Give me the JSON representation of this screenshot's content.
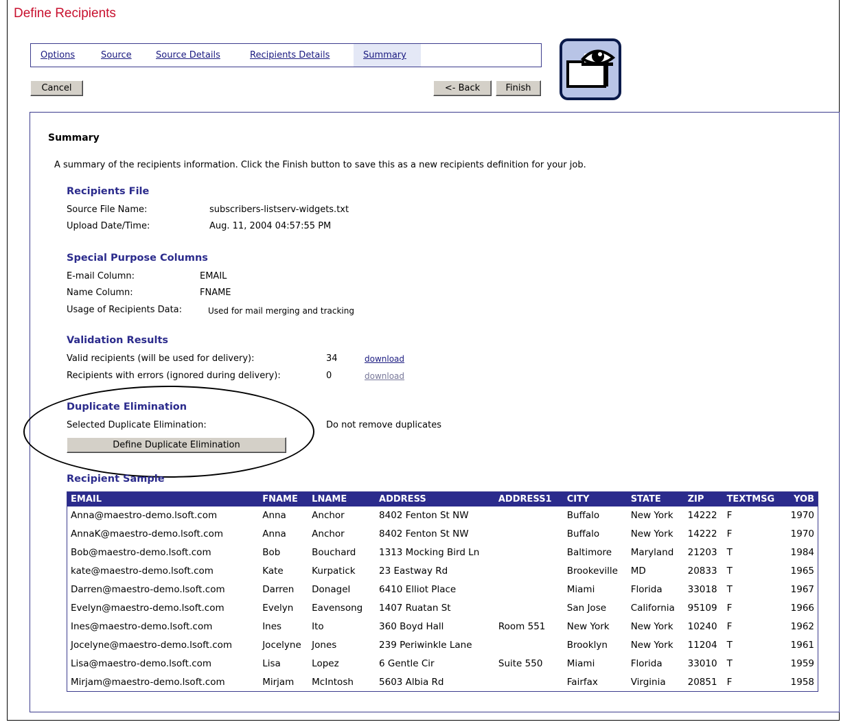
{
  "page_title": "Define Recipients",
  "tabs": [
    {
      "label": "Options"
    },
    {
      "label": "Source"
    },
    {
      "label": "Source Details"
    },
    {
      "label": "Recipients Details"
    },
    {
      "label": "Summary",
      "active": true
    }
  ],
  "buttons": {
    "cancel": "Cancel",
    "back": "<- Back",
    "finish": "Finish"
  },
  "logo_icon": "eye-envelope-icon",
  "summary": {
    "heading": "Summary",
    "description": "A summary of the recipients information. Click the Finish button to save this as a new recipients definition for your job.",
    "recipients_file": {
      "title": "Recipients File",
      "source_label": "Source File Name:",
      "source_value": "subscribers-listserv-widgets.txt",
      "upload_label": "Upload Date/Time:",
      "upload_value": "Aug. 11, 2004 04:57:55 PM"
    },
    "special_columns": {
      "title": "Special Purpose Columns",
      "email_label": "E-mail Column:",
      "email_value": "EMAIL",
      "name_label": "Name Column:",
      "name_value": "FNAME",
      "usage_label": "Usage of Recipients Data:",
      "usage_value": "Used for mail merging and tracking"
    },
    "validation": {
      "title": "Validation Results",
      "valid_label": "Valid recipients (will be used for delivery):",
      "valid_count": "34",
      "valid_link": "download",
      "errors_label": "Recipients with errors (ignored during delivery):",
      "errors_count": "0",
      "errors_link": "download"
    },
    "duplicates": {
      "title": "Duplicate Elimination",
      "selected_label": "Selected Duplicate Elimination:",
      "selected_value": "Do not remove duplicates",
      "button": "Define Duplicate Elimination"
    },
    "sample": {
      "title": "Recipient Sample",
      "columns": [
        "EMAIL",
        "FNAME",
        "LNAME",
        "ADDRESS",
        "ADDRESS1",
        "CITY",
        "STATE",
        "ZIP",
        "TEXTMSG",
        "YOB"
      ],
      "rows": [
        [
          "Anna@maestro-demo.lsoft.com",
          "Anna",
          "Anchor",
          "8402 Fenton St NW",
          "",
          "Buffalo",
          "New York",
          "14222",
          "F",
          "1970"
        ],
        [
          "AnnaK@maestro-demo.lsoft.com",
          "Anna",
          "Anchor",
          "8402 Fenton St NW",
          "",
          "Buffalo",
          "New York",
          "14222",
          "F",
          "1970"
        ],
        [
          "Bob@maestro-demo.lsoft.com",
          "Bob",
          "Bouchard",
          "1313 Mocking Bird Ln",
          "",
          "Baltimore",
          "Maryland",
          "21203",
          "T",
          "1984"
        ],
        [
          "kate@maestro-demo.lsoft.com",
          "Kate",
          "Kurpatick",
          "23 Eastway Rd",
          "",
          "Brookeville",
          "MD",
          "20833",
          "T",
          "1965"
        ],
        [
          "Darren@maestro-demo.lsoft.com",
          "Darren",
          "Donagel",
          "6410 Elliot Place",
          "",
          "Miami",
          "Florida",
          "33018",
          "T",
          "1967"
        ],
        [
          "Evelyn@maestro-demo.lsoft.com",
          "Evelyn",
          "Eavensong",
          "1407 Ruatan St",
          "",
          "San Jose",
          "California",
          "95109",
          "F",
          "1966"
        ],
        [
          "Ines@maestro-demo.lsoft.com",
          "Ines",
          "Ito",
          "360 Boyd Hall",
          "Room 551",
          "New York",
          "New York",
          "10240",
          "F",
          "1962"
        ],
        [
          "Jocelyne@maestro-demo.lsoft.com",
          "Jocelyne",
          "Jones",
          "239 Periwinkle Lane",
          "",
          "Brooklyn",
          "New York",
          "11204",
          "T",
          "1961"
        ],
        [
          "Lisa@maestro-demo.lsoft.com",
          "Lisa",
          "Lopez",
          "6 Gentle Cir",
          "Suite 550",
          "Miami",
          "Florida",
          "33010",
          "T",
          "1959"
        ],
        [
          "Mirjam@maestro-demo.lsoft.com",
          "Mirjam",
          "McIntosh",
          "5603 Albia Rd",
          "",
          "Fairfax",
          "Virginia",
          "20851",
          "F",
          "1958"
        ]
      ]
    }
  }
}
